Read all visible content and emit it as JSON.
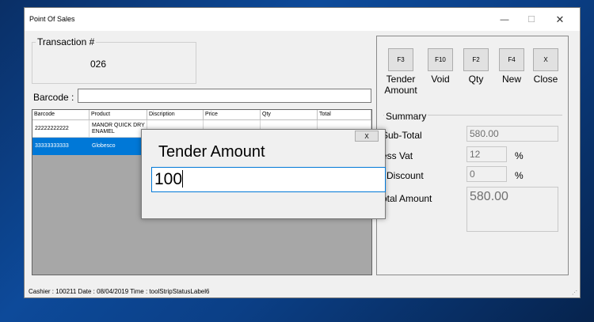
{
  "window": {
    "title": "Point Of Sales",
    "min_glyph": "—",
    "max_glyph": "☐",
    "close_glyph": "✕"
  },
  "transaction": {
    "label": "Transaction #",
    "number": "026"
  },
  "barcode": {
    "label": "Barcode :",
    "value": ""
  },
  "grid": {
    "columns": [
      "Barcode",
      "Product",
      "Discription",
      "Price",
      "Qty",
      "Total"
    ],
    "rows": [
      [
        "22222222222",
        "MANOR QUICK DRY ENAMEL",
        "",
        "",
        "",
        ""
      ],
      [
        "33333333333",
        "Globesco",
        "",
        "",
        "",
        ""
      ]
    ],
    "selected_row": 1
  },
  "function_keys": [
    {
      "key": "F3",
      "label": "Tender Amount"
    },
    {
      "key": "F10",
      "label": "Void"
    },
    {
      "key": "F2",
      "label": "Qty"
    },
    {
      "key": "F4",
      "label": "New"
    },
    {
      "key": "X",
      "label": "Close"
    }
  ],
  "summary": {
    "title": "Summary",
    "subtotal_label": "Sub-Total",
    "subtotal_value": "580.00",
    "vat_label": "ess Vat",
    "vat_value": "12",
    "vat_unit": "%",
    "discount_label": "l Discount",
    "discount_value": "0",
    "discount_unit": "%",
    "total_label": "otal Amount",
    "total_value": "580.00"
  },
  "statusbar": {
    "text": "Cashier : 100211   Date :  08/04/2019   Time :  toolStripStatusLabel6"
  },
  "dialog": {
    "title": "Tender Amount",
    "input_value": "100",
    "close_label": "X"
  },
  "colors": {
    "selection": "#0078d7",
    "desktop": "#0d4a9a"
  }
}
